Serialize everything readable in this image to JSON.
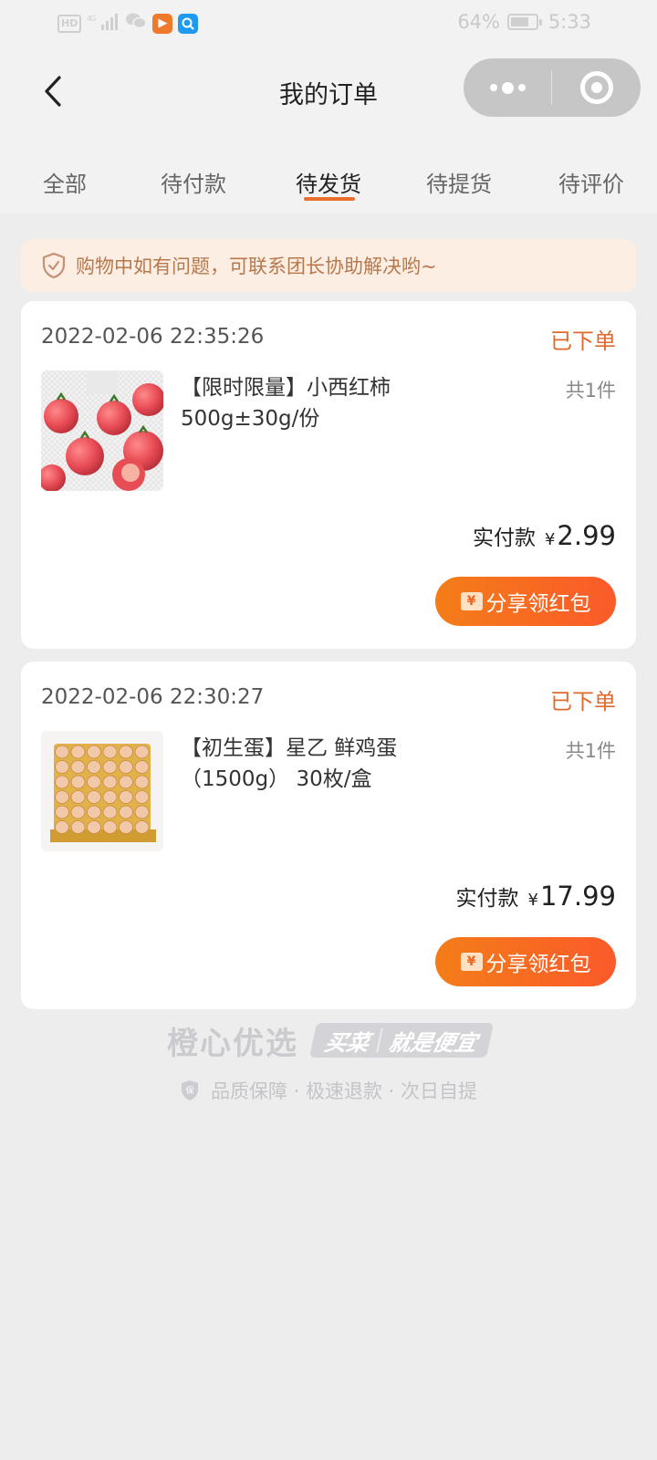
{
  "status_bar": {
    "network": "HD",
    "signal": "4G",
    "battery": "64%",
    "time": "5:33"
  },
  "nav": {
    "title": "我的订单",
    "back_icon": "chevron-left-icon",
    "more_icon": "more-dots-icon",
    "close_icon": "target-close-icon"
  },
  "tabs": [
    {
      "label": "全部",
      "active": false
    },
    {
      "label": "待付款",
      "active": false
    },
    {
      "label": "待发货",
      "active": true
    },
    {
      "label": "待提货",
      "active": false
    },
    {
      "label": "待评价",
      "active": false
    }
  ],
  "notice": {
    "text": "购物中如有问题，可联系团长协助解决哟~",
    "icon": "shield-check-icon"
  },
  "orders": [
    {
      "time": "2022-02-06 22:35:26",
      "status": "已下单",
      "product_name": "【限时限量】小西红柿500g±30g/份",
      "quantity": "共1件",
      "paid_label": "实付款",
      "currency": "¥",
      "amount": "2.99",
      "share_label": "分享领红包"
    },
    {
      "time": "2022-02-06 22:30:27",
      "status": "已下单",
      "product_name": "【初生蛋】星乙 鲜鸡蛋（1500g） 30枚/盒",
      "quantity": "共1件",
      "paid_label": "实付款",
      "currency": "¥",
      "amount": "17.99",
      "share_label": "分享领红包"
    }
  ],
  "footer": {
    "brand": "橙心优选",
    "slogan_a": "买菜",
    "slogan_b": "就是便宜",
    "guarantee": "品质保障 · 极速退款 · 次日自提",
    "guarantee_icon_text": "保"
  },
  "colors": {
    "accent": "#e8702a",
    "status": "#e06a2d",
    "button_from": "#f47d18",
    "button_to": "#fb5a2a"
  }
}
